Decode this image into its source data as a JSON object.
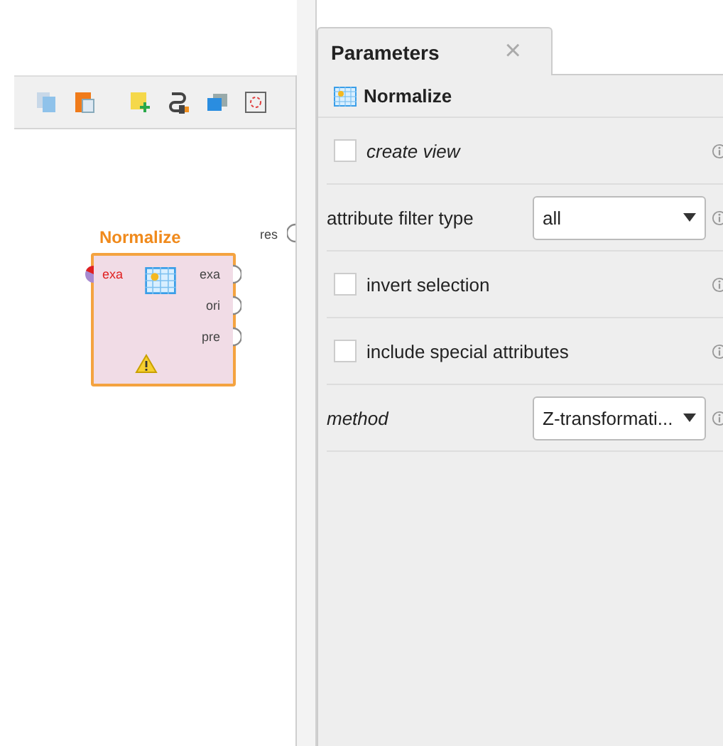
{
  "canvas": {
    "result_port": {
      "label": "res"
    },
    "operator": {
      "title": "Normalize",
      "warning": true,
      "input_ports": [
        {
          "label": "exa"
        }
      ],
      "output_ports": [
        {
          "label": "exa"
        },
        {
          "label": "ori"
        },
        {
          "label": "pre"
        }
      ]
    }
  },
  "panel": {
    "tab": {
      "label": "Parameters",
      "close": "×",
      "selected": true
    },
    "operator_name": "Normalize",
    "parameters": [
      {
        "kind": "checkbox",
        "label": "create view",
        "italic": true,
        "checked": false
      },
      {
        "kind": "select",
        "label": "attribute filter type",
        "italic": false,
        "value": "all"
      },
      {
        "kind": "checkbox",
        "label": "invert selection",
        "italic": false,
        "checked": false
      },
      {
        "kind": "checkbox",
        "label": "include special attributes",
        "italic": false,
        "checked": false
      },
      {
        "kind": "select",
        "label": "method",
        "italic": true,
        "value": "Z-transformati..."
      }
    ]
  }
}
